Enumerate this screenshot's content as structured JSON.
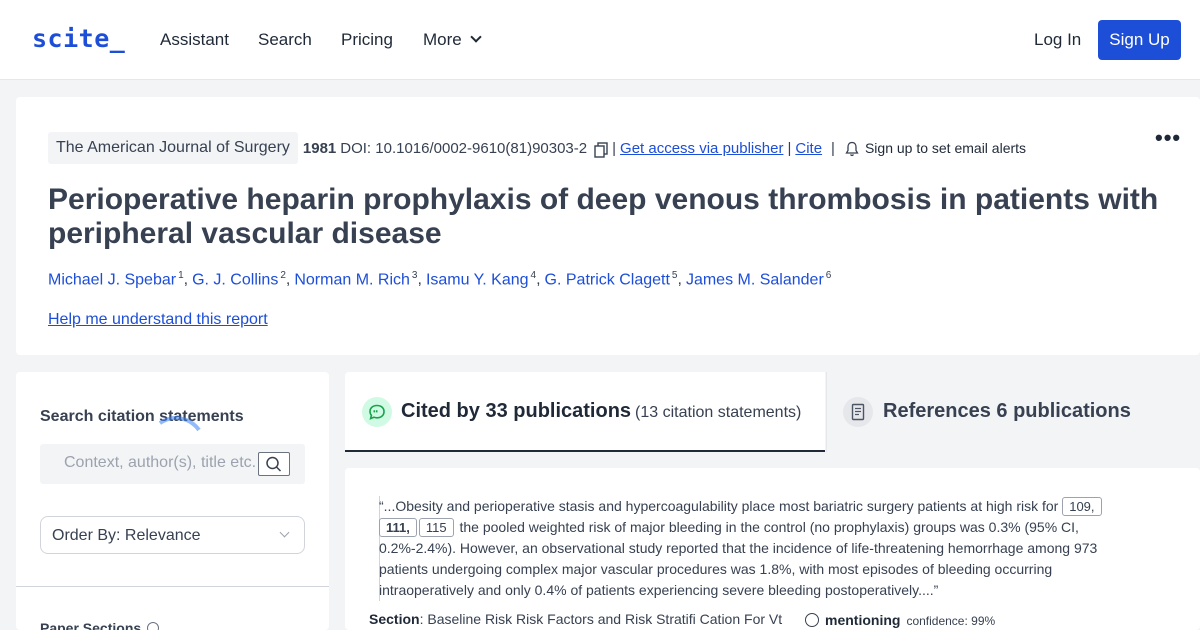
{
  "nav": {
    "logo": "scite_",
    "links": [
      "Assistant",
      "Search",
      "Pricing",
      "More"
    ],
    "login": "Log In",
    "signup": "Sign Up"
  },
  "paper": {
    "journal": "The American Journal of Surgery",
    "year": "1981",
    "doi": "DOI: 10.1016/0002-9610(81)90303-2",
    "access_link": "Get access via publisher",
    "cite_link": "Cite",
    "alerts": "Sign up to set email alerts",
    "title": "Perioperative heparin prophylaxis of deep venous thrombosis in patients with peripheral vascular disease",
    "authors": [
      {
        "name": "Michael J. Spebar",
        "sup": "1"
      },
      {
        "name": "G. J. Collins",
        "sup": "2"
      },
      {
        "name": "Norman M. Rich",
        "sup": "3"
      },
      {
        "name": "Isamu Y. Kang",
        "sup": "4"
      },
      {
        "name": "G. Patrick Clagett",
        "sup": "5"
      },
      {
        "name": "James M. Salander",
        "sup": "6"
      }
    ],
    "help_link": "Help me understand this report"
  },
  "sidebar": {
    "search_label": "Search citation statements",
    "search_placeholder": "Context, author(s), title etc.",
    "order_by": "Order By: Relevance",
    "sections_label": "Paper Sections"
  },
  "tabs": {
    "cited_title": "Cited by 33 publications",
    "cited_sub": "(13 citation statements)",
    "refs_title": "References 6 publications"
  },
  "citation": {
    "quote_start": "“...Obesity and perioperative stasis and hypercoagulability place most bariatric surgery patients at high risk for",
    "refs": [
      "109,",
      "111,",
      "115"
    ],
    "quote_rest": "the pooled weighted risk of major bleeding in the control (no prophylaxis) groups was 0.3% (95% CI, 0.2%-2.4%). However, an observational study reported that the incidence of life-threatening hemorrhage among 973 patients undergoing complex major vascular procedures was 1.8%, with most episodes of bleeding occurring intraoperatively and only 0.4% of patients experiencing severe bleeding postoperatively....”",
    "section_label": "Section",
    "section_value": ": Baseline Risk Risk Factors and Risk Stratifi Cation For Vt",
    "mention_label": "mentioning",
    "confidence": "confidence: 99%"
  },
  "colors": {
    "brand": "#1d4ed8",
    "background": "#f3f4f6",
    "cited_icon_bg": "#d1fae5",
    "cited_icon": "#16a34a"
  }
}
